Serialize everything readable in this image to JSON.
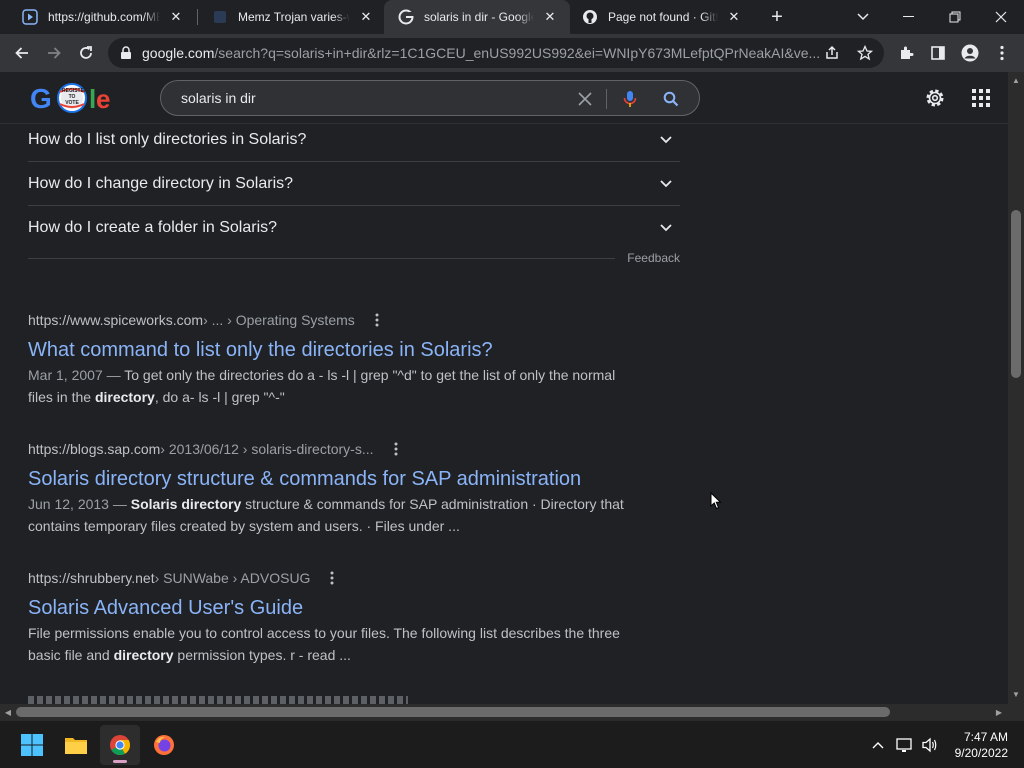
{
  "browser": {
    "tabs": [
      {
        "title": "https://github.com/ME",
        "favicon": "play-icon"
      },
      {
        "title": "Memz Trojan varies-wit",
        "favicon": "blank-page-icon"
      },
      {
        "title": "solaris in dir - Google S",
        "favicon": "google-icon"
      },
      {
        "title": "Page not found · GitHu",
        "favicon": "github-icon"
      }
    ],
    "active_tab_index": 2,
    "url_host": "google.com",
    "url_rest": "/search?q=solaris+in+dir&rlz=1C1GCEU_enUS992US992&ei=WNIpY673MLefptQPrNeakAI&ve..."
  },
  "search": {
    "query": "solaris in dir",
    "logo_badge": "REGISTER TO VOTE"
  },
  "people_also_ask": [
    "How do I list only directories in Solaris?",
    "How do I change directory in Solaris?",
    "How do I create a folder in Solaris?"
  ],
  "feedback_label": "Feedback",
  "results": [
    {
      "site": "https://www.spiceworks.com",
      "path": " › ... › Operating Systems",
      "title": "What command to list only the directories in Solaris?",
      "date": "Mar 1, 2007 — ",
      "snippet_parts": [
        {
          "t": "To get only the directories do a - ls -l | grep \"^d\" to get the list of only the normal files in the ",
          "b": false
        },
        {
          "t": "directory",
          "b": true
        },
        {
          "t": ", do a- ls -l | grep \"^-\"",
          "b": false
        }
      ]
    },
    {
      "site": "https://blogs.sap.com",
      "path": " › 2013/06/12 › solaris-directory-s...",
      "title": "Solaris directory structure & commands for SAP administration",
      "date": "Jun 12, 2013 — ",
      "snippet_parts": [
        {
          "t": "Solaris directory",
          "b": true
        },
        {
          "t": " structure & commands for SAP administration · Directory that contains temporary files created by system and users. · Files under ...",
          "b": false
        }
      ]
    },
    {
      "site": "https://shrubbery.net",
      "path": " › SUNWabe › ADVOSUG",
      "title": "Solaris Advanced User's Guide",
      "date": "",
      "snippet_parts": [
        {
          "t": "File permissions enable you to control access to your files. The following list describes the three basic file and ",
          "b": false
        },
        {
          "t": "directory",
          "b": true
        },
        {
          "t": " permission types. r - read ...",
          "b": false
        }
      ]
    }
  ],
  "taskbar": {
    "time": "7:47 AM",
    "date": "9/20/2022",
    "apps": [
      "windows-start",
      "file-explorer",
      "chrome",
      "firefox"
    ]
  }
}
